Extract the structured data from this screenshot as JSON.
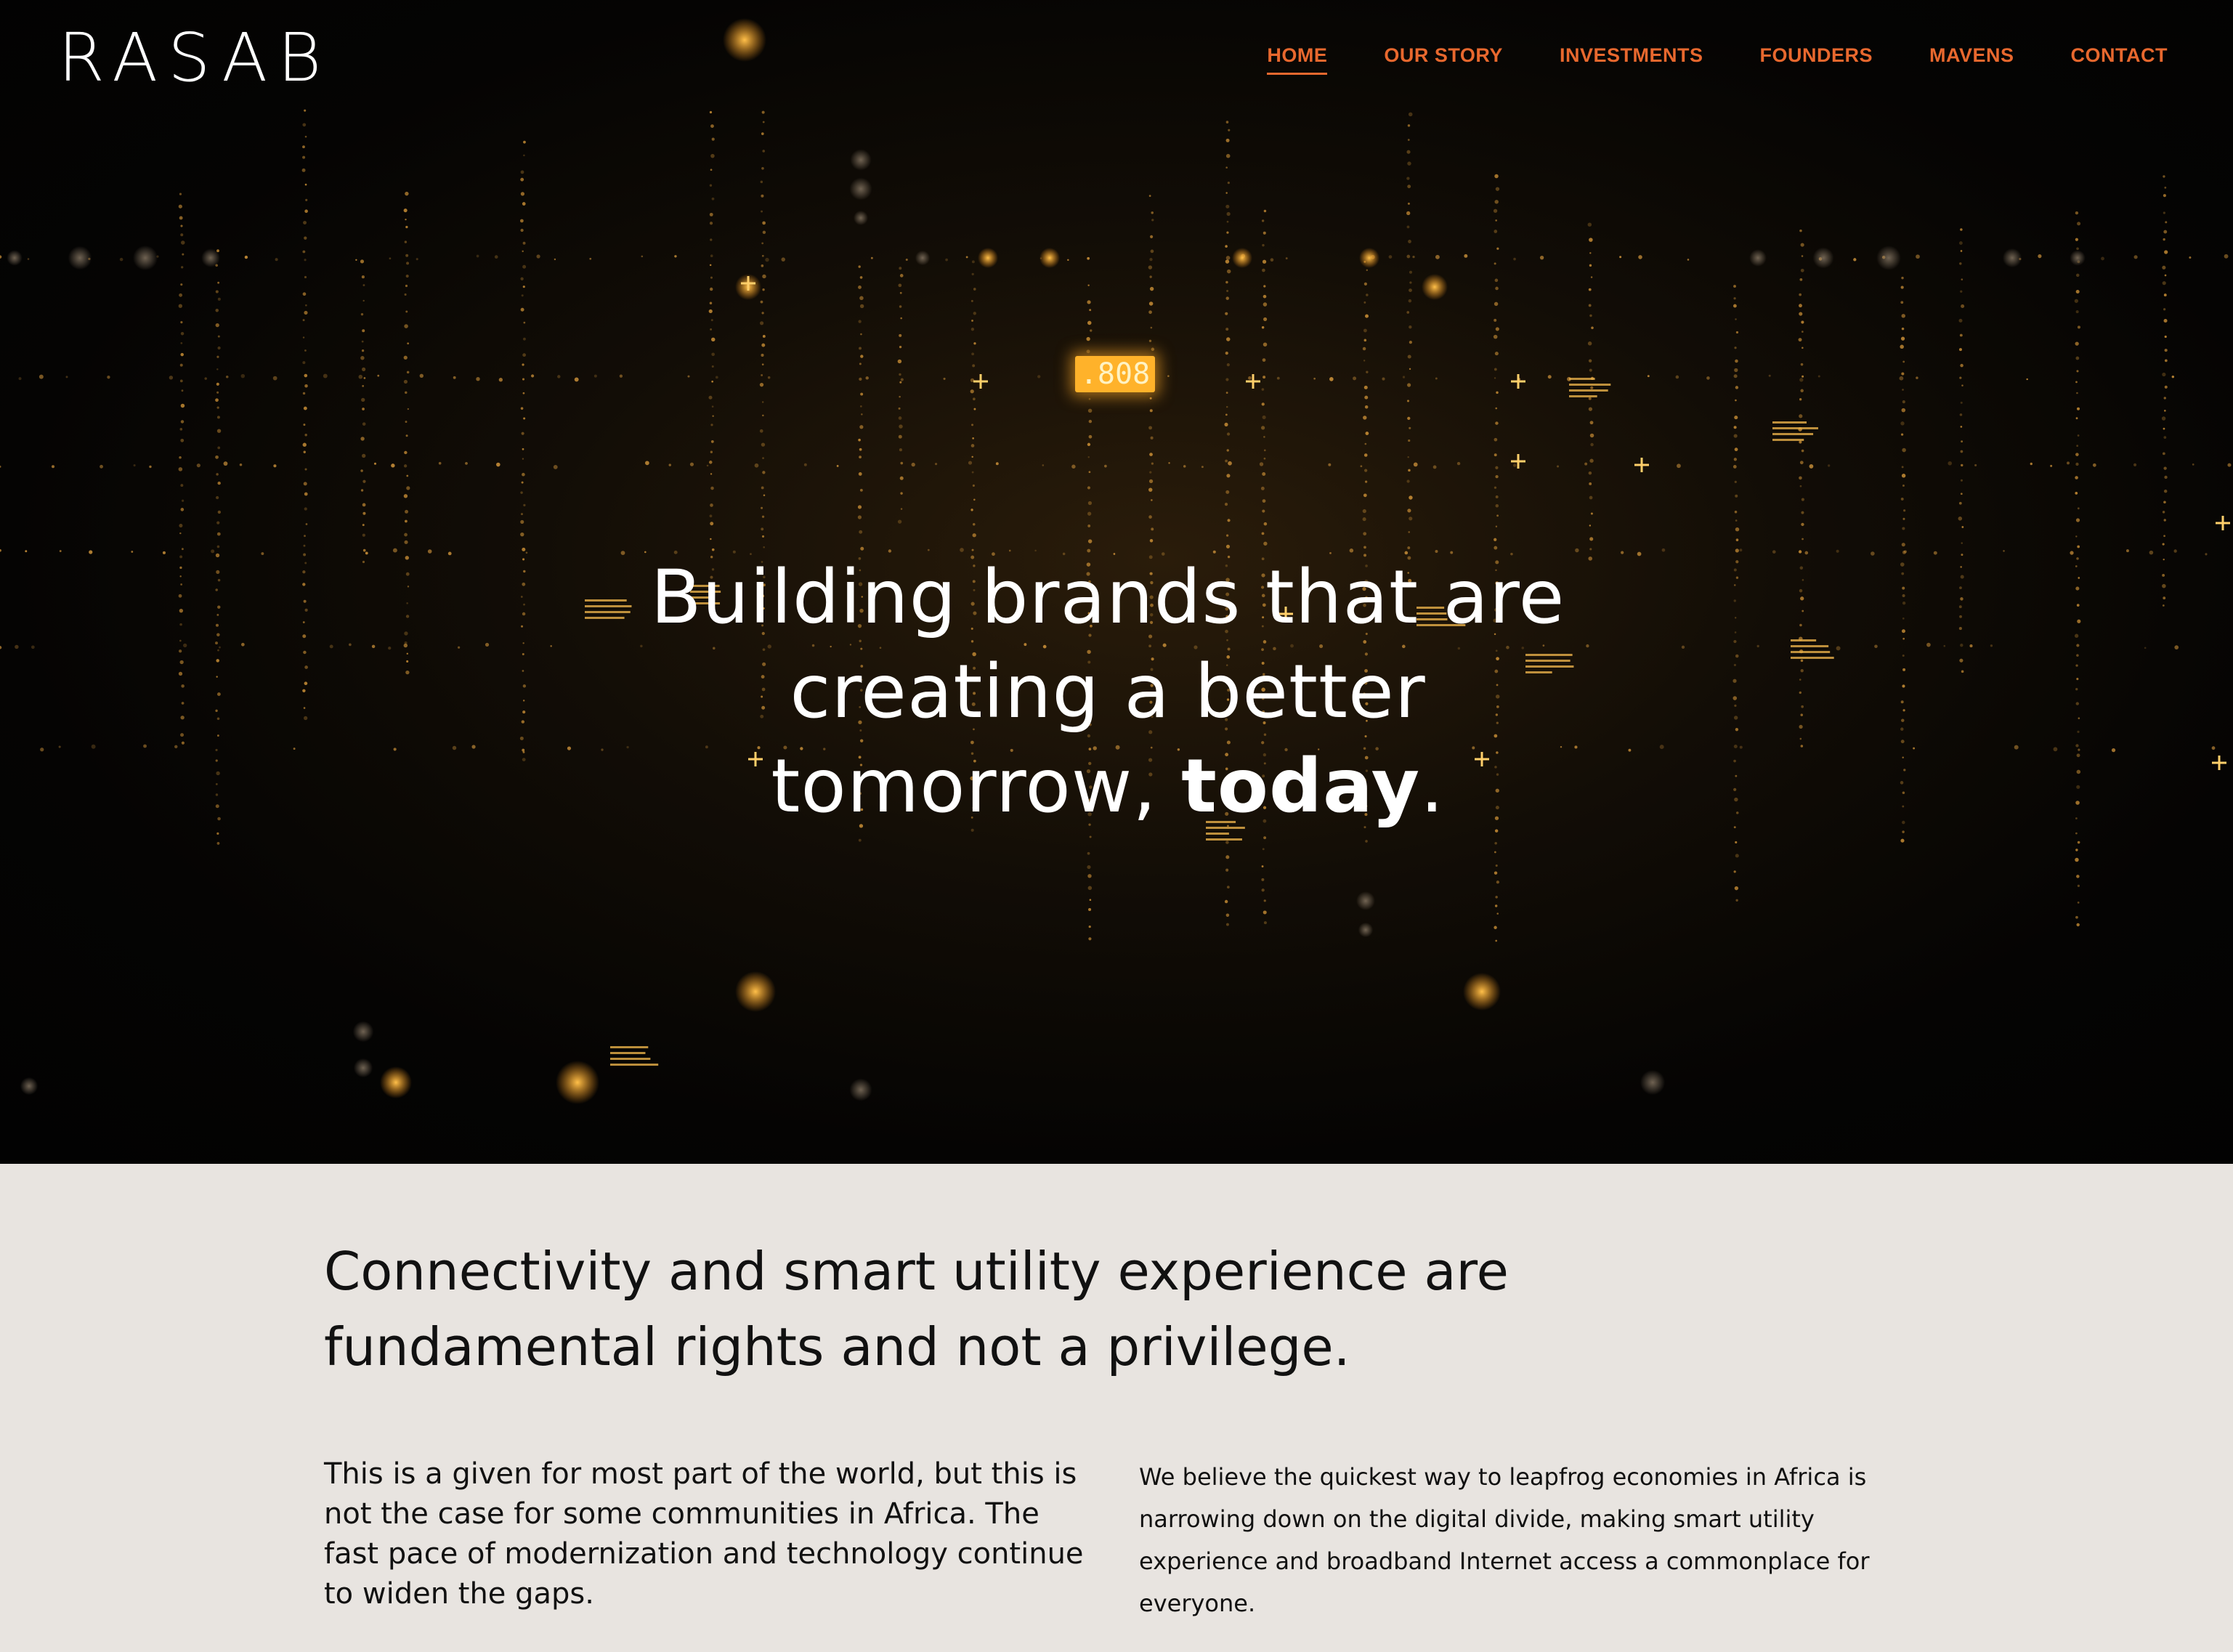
{
  "header": {
    "logo_text": "RASAB",
    "nav": [
      {
        "label": "HOME",
        "active": true
      },
      {
        "label": "OUR STORY",
        "active": false
      },
      {
        "label": "INVESTMENTS",
        "active": false
      },
      {
        "label": "FOUNDERS",
        "active": false
      },
      {
        "label": "MAVENS",
        "active": false
      },
      {
        "label": "CONTACT",
        "active": false
      }
    ]
  },
  "hero": {
    "line1": "Building brands that are",
    "line2": "creating a better",
    "line3_prefix": "tomorrow, ",
    "line3_bold": "today",
    "line3_suffix": ".",
    "counter_text": ".808"
  },
  "mission": {
    "heading": "Connectivity and smart utility experience are fundamental rights and not a privilege.",
    "left_paragraph": "This is a given for most part of the world, but this is not the case for some communities in Africa. The fast pace of modernization and technology continue to widen the gaps.",
    "right_paragraph": "We believe the quickest way to leapfrog economies in Africa is narrowing down on the digital divide, making smart utility experience and broadband Internet access a commonplace for everyone."
  },
  "colors": {
    "accent": "#e8682e",
    "hero_bg": "#050403",
    "lower_bg": "#e8e4e0",
    "glow": "#ffb22a"
  }
}
